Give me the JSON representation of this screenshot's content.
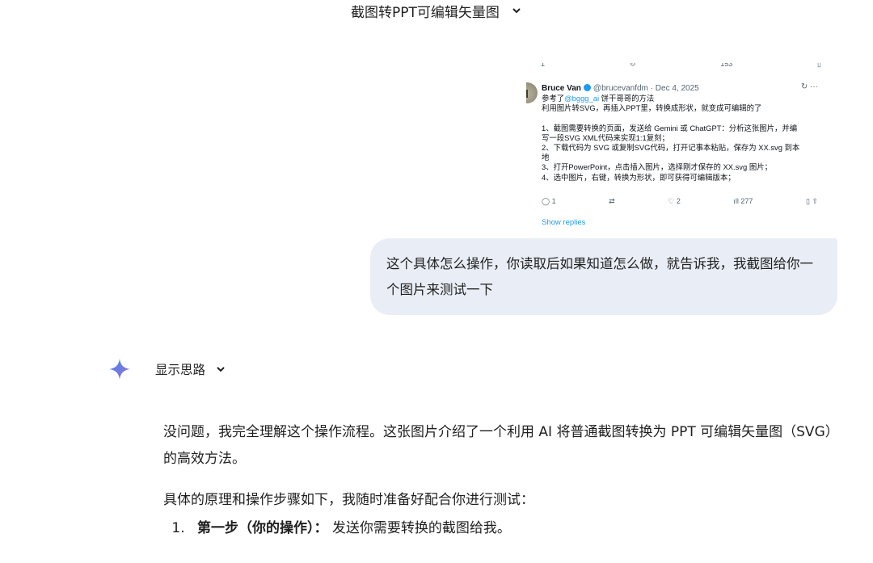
{
  "header": {
    "title": "截图转PPT可编辑矢量图",
    "chevron_icon": "chevron-down-icon"
  },
  "tweet_screenshot": {
    "top_counts": {
      "reply": "1",
      "views": "153"
    },
    "author_name": "Bruce Van",
    "handle": "@brucevanfdm",
    "date": "Dec 4, 2025",
    "text_prefix": "参考了",
    "mention": "@bggg_ai",
    "text_suffix": " 饼干哥哥的方法",
    "lines": [
      "利用图片转SVG，再插入PPT里，转换成形状，就变成可编辑的了",
      "",
      "1、截图需要转换的页面，发送给 Gemini 或 ChatGPT：分析这张图片，并编",
      "写一段SVG XML代码来实现1:1复刻；",
      "2、下载代码为 SVG 或复制SVG代码，打开记事本粘贴，保存为 XX.svg 到本",
      "地",
      "3、打开PowerPoint，点击插入图片，选择刚才保存的 XX.svg 图片；",
      "4、选中图片，右键，转换为形状，即可获得可编辑版本；"
    ],
    "actions": {
      "replies": "1",
      "likes": "2",
      "views": "277"
    },
    "show_replies": "Show replies"
  },
  "user_message": "这个具体怎么操作，你读取后如果知道怎么做，就告诉我，我截图给你一个图片来测试一下",
  "thinking": {
    "label": "显示思路"
  },
  "response": {
    "para1": "没问题，我完全理解这个操作流程。这张图片介绍了一个利用 AI 将普通截图转换为 PPT 可编辑矢量图（SVG）的高效方法。",
    "para2": "具体的原理和操作步骤如下，我随时准备好配合你进行测试：",
    "steps": [
      {
        "bold": "第一步（你的操作）：",
        "text": " 发送你需要转换的截图给我。"
      }
    ]
  },
  "colors": {
    "bubble_bg": "#e9eef6",
    "link": "#1d9bf0",
    "spark_start": "#4285f4",
    "spark_end": "#9b72cb"
  }
}
